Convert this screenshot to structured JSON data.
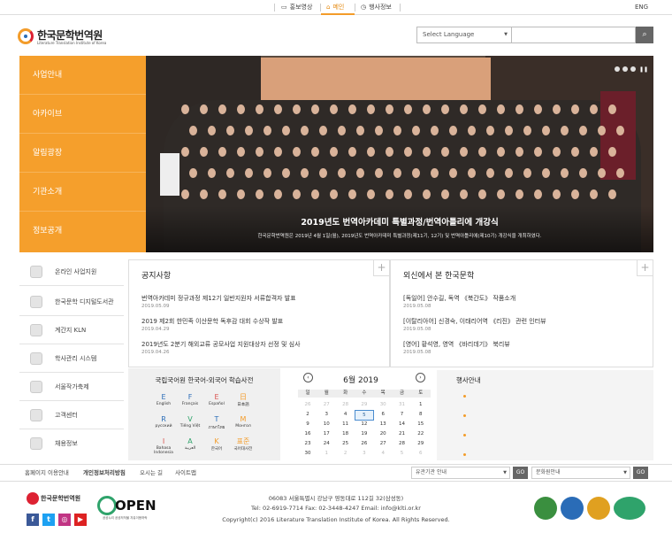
{
  "topbar": {
    "tabs": [
      {
        "label": "홍보영상",
        "icon": "tv-icon"
      },
      {
        "label": "메인",
        "icon": "home-icon"
      },
      {
        "label": "행사정보",
        "icon": "clock-icon"
      }
    ],
    "lang_link": "ENG"
  },
  "header": {
    "logo_title": "한국문학번역원",
    "logo_subtitle": "Literature Translation Institute of Korea",
    "language_select": "Select Language",
    "search_placeholder": ""
  },
  "menu": {
    "items": [
      "사업안내",
      "아카이브",
      "알림광장",
      "기관소개",
      "정보공개"
    ]
  },
  "hero": {
    "caption": "2019년도 번역아카데미 특별과정/번역아틀리에 개강식",
    "subcaption": "한국문학번역원은 2019년 4월 1일(월), 2019년도 번역아카데미 특별과정(제11기, 12기) 및 번역아틀리에(제10기) 개강식을 개최하였다."
  },
  "quicklinks": [
    {
      "label": "온라인 사업지원",
      "icon": "monitor-icon"
    },
    {
      "label": "한국문학 디지털도서관",
      "icon": "book-icon"
    },
    {
      "label": "계간지 KLN",
      "icon": "magazine-icon"
    },
    {
      "label": "학사관리 시스템",
      "icon": "academy-icon"
    },
    {
      "label": "서울작가축제",
      "icon": "festival-icon"
    },
    {
      "label": "고객센터",
      "icon": "headset-icon"
    },
    {
      "label": "채용정보",
      "icon": "person-icon"
    }
  ],
  "notices": {
    "title": "공지사항",
    "items": [
      {
        "text": "번역아카데미 정규과정 제12기 일반지원자 서류합격자 발표",
        "date": "2019.05.09"
      },
      {
        "text": "2019 제2회 한민족 이산문학 독후감 대회 수상작 발표",
        "date": "2019.04.29"
      },
      {
        "text": "2019년도 2분기 해외교류 공모사업 지원대상자 선정 및 심사",
        "date": "2019.04.26"
      }
    ]
  },
  "foreign": {
    "title": "외신에서 본 한국문학",
    "items": [
      {
        "text": "[독일어] 안수길, 독역 《북간도》 작품소개",
        "date": "2019.05.08"
      },
      {
        "text": "[이탈리아어] 신경숙, 이태리어역 《리진》 관련 인터뷰",
        "date": "2019.05.08"
      },
      {
        "text": "[영어] 황석영, 영역 《바리데기》 북리뷰",
        "date": "2019.05.08"
      }
    ]
  },
  "dictionary": {
    "title": "국립국어원 한국어-외국어 학습사전",
    "langs": [
      {
        "letter": "E",
        "name": "English",
        "color": "#2a6cb7"
      },
      {
        "letter": "F",
        "name": "Français",
        "color": "#2a6cb7"
      },
      {
        "letter": "E",
        "name": "Español",
        "color": "#d9534f"
      },
      {
        "letter": "日",
        "name": "日本語",
        "color": "#f39c2a"
      },
      {
        "letter": "R",
        "name": "русский",
        "color": "#2a6cb7"
      },
      {
        "letter": "V",
        "name": "Tiếng Việt",
        "color": "#2fa36b"
      },
      {
        "letter": "T",
        "name": "ภาษาไทย",
        "color": "#2a6cb7"
      },
      {
        "letter": "M",
        "name": "Монгол",
        "color": "#f39c2a"
      },
      {
        "letter": "I",
        "name": "Bahasa Indonesia",
        "color": "#d9534f"
      },
      {
        "letter": "A",
        "name": "العربية",
        "color": "#2fa36b"
      },
      {
        "letter": "K",
        "name": "한국어",
        "color": "#f39c2a"
      },
      {
        "letter": "표준",
        "name": "국어대사전",
        "color": "#f39c2a"
      }
    ]
  },
  "calendar": {
    "title": "6월 2019",
    "prev": "‹",
    "next": "›",
    "weekdays": [
      "일",
      "월",
      "화",
      "수",
      "목",
      "금",
      "토"
    ],
    "weeks": [
      [
        {
          "d": "26",
          "m": true
        },
        {
          "d": "27",
          "m": true
        },
        {
          "d": "28",
          "m": true
        },
        {
          "d": "29",
          "m": true
        },
        {
          "d": "30",
          "m": true
        },
        {
          "d": "31",
          "m": true
        },
        {
          "d": "1"
        }
      ],
      [
        {
          "d": "2"
        },
        {
          "d": "3"
        },
        {
          "d": "4"
        },
        {
          "d": "5",
          "t": true
        },
        {
          "d": "6"
        },
        {
          "d": "7"
        },
        {
          "d": "8"
        }
      ],
      [
        {
          "d": "9"
        },
        {
          "d": "10"
        },
        {
          "d": "11"
        },
        {
          "d": "12"
        },
        {
          "d": "13"
        },
        {
          "d": "14"
        },
        {
          "d": "15"
        }
      ],
      [
        {
          "d": "16"
        },
        {
          "d": "17"
        },
        {
          "d": "18"
        },
        {
          "d": "19"
        },
        {
          "d": "20"
        },
        {
          "d": "21"
        },
        {
          "d": "22"
        }
      ],
      [
        {
          "d": "23"
        },
        {
          "d": "24"
        },
        {
          "d": "25"
        },
        {
          "d": "26"
        },
        {
          "d": "27"
        },
        {
          "d": "28"
        },
        {
          "d": "29"
        }
      ],
      [
        {
          "d": "30"
        },
        {
          "d": "1",
          "m": true
        },
        {
          "d": "2",
          "m": true
        },
        {
          "d": "3",
          "m": true
        },
        {
          "d": "4",
          "m": true
        },
        {
          "d": "5",
          "m": true
        },
        {
          "d": "6",
          "m": true
        }
      ]
    ]
  },
  "events": {
    "title": "행사안내"
  },
  "footer": {
    "links": [
      "홈페이지 이용안내",
      "개인정보처리방침",
      "오시는 길",
      "사이트맵"
    ],
    "related_select": "유관기관 안내",
    "culture_select": "문화원안내",
    "go_label": "GO",
    "logo_text": "한국문학번역원",
    "open_text": "OPEN",
    "open_sub": "공공누리 공공저작물 자유이용허락",
    "address": "06083 서울특별시 강남구 영동대로 112길 32(삼성동)",
    "contact": "Tel: 02-6919-7714 Fax: 02-3448-4247 Email: info@klti.or.kr",
    "copyright": "Copyright(c) 2016 Literature Translation Institute of Korea. All Rights Reserved.",
    "social": [
      {
        "icon": "facebook-icon",
        "glyph": "f",
        "color": "#3b5998"
      },
      {
        "icon": "twitter-icon",
        "glyph": "t",
        "color": "#1da1f2"
      },
      {
        "icon": "instagram-icon",
        "glyph": "◎",
        "color": "#c13584"
      },
      {
        "icon": "youtube-icon",
        "glyph": "▶",
        "color": "#d22"
      }
    ],
    "certs": [
      {
        "icon": "g-cert-icon",
        "color": "#3a8f3f"
      },
      {
        "icon": "cert-2-icon",
        "color": "#2a6cb7"
      },
      {
        "icon": "cert-3-icon",
        "color": "#e0a020"
      },
      {
        "icon": "wa-cert-icon",
        "color": "#2fa36b"
      }
    ]
  }
}
